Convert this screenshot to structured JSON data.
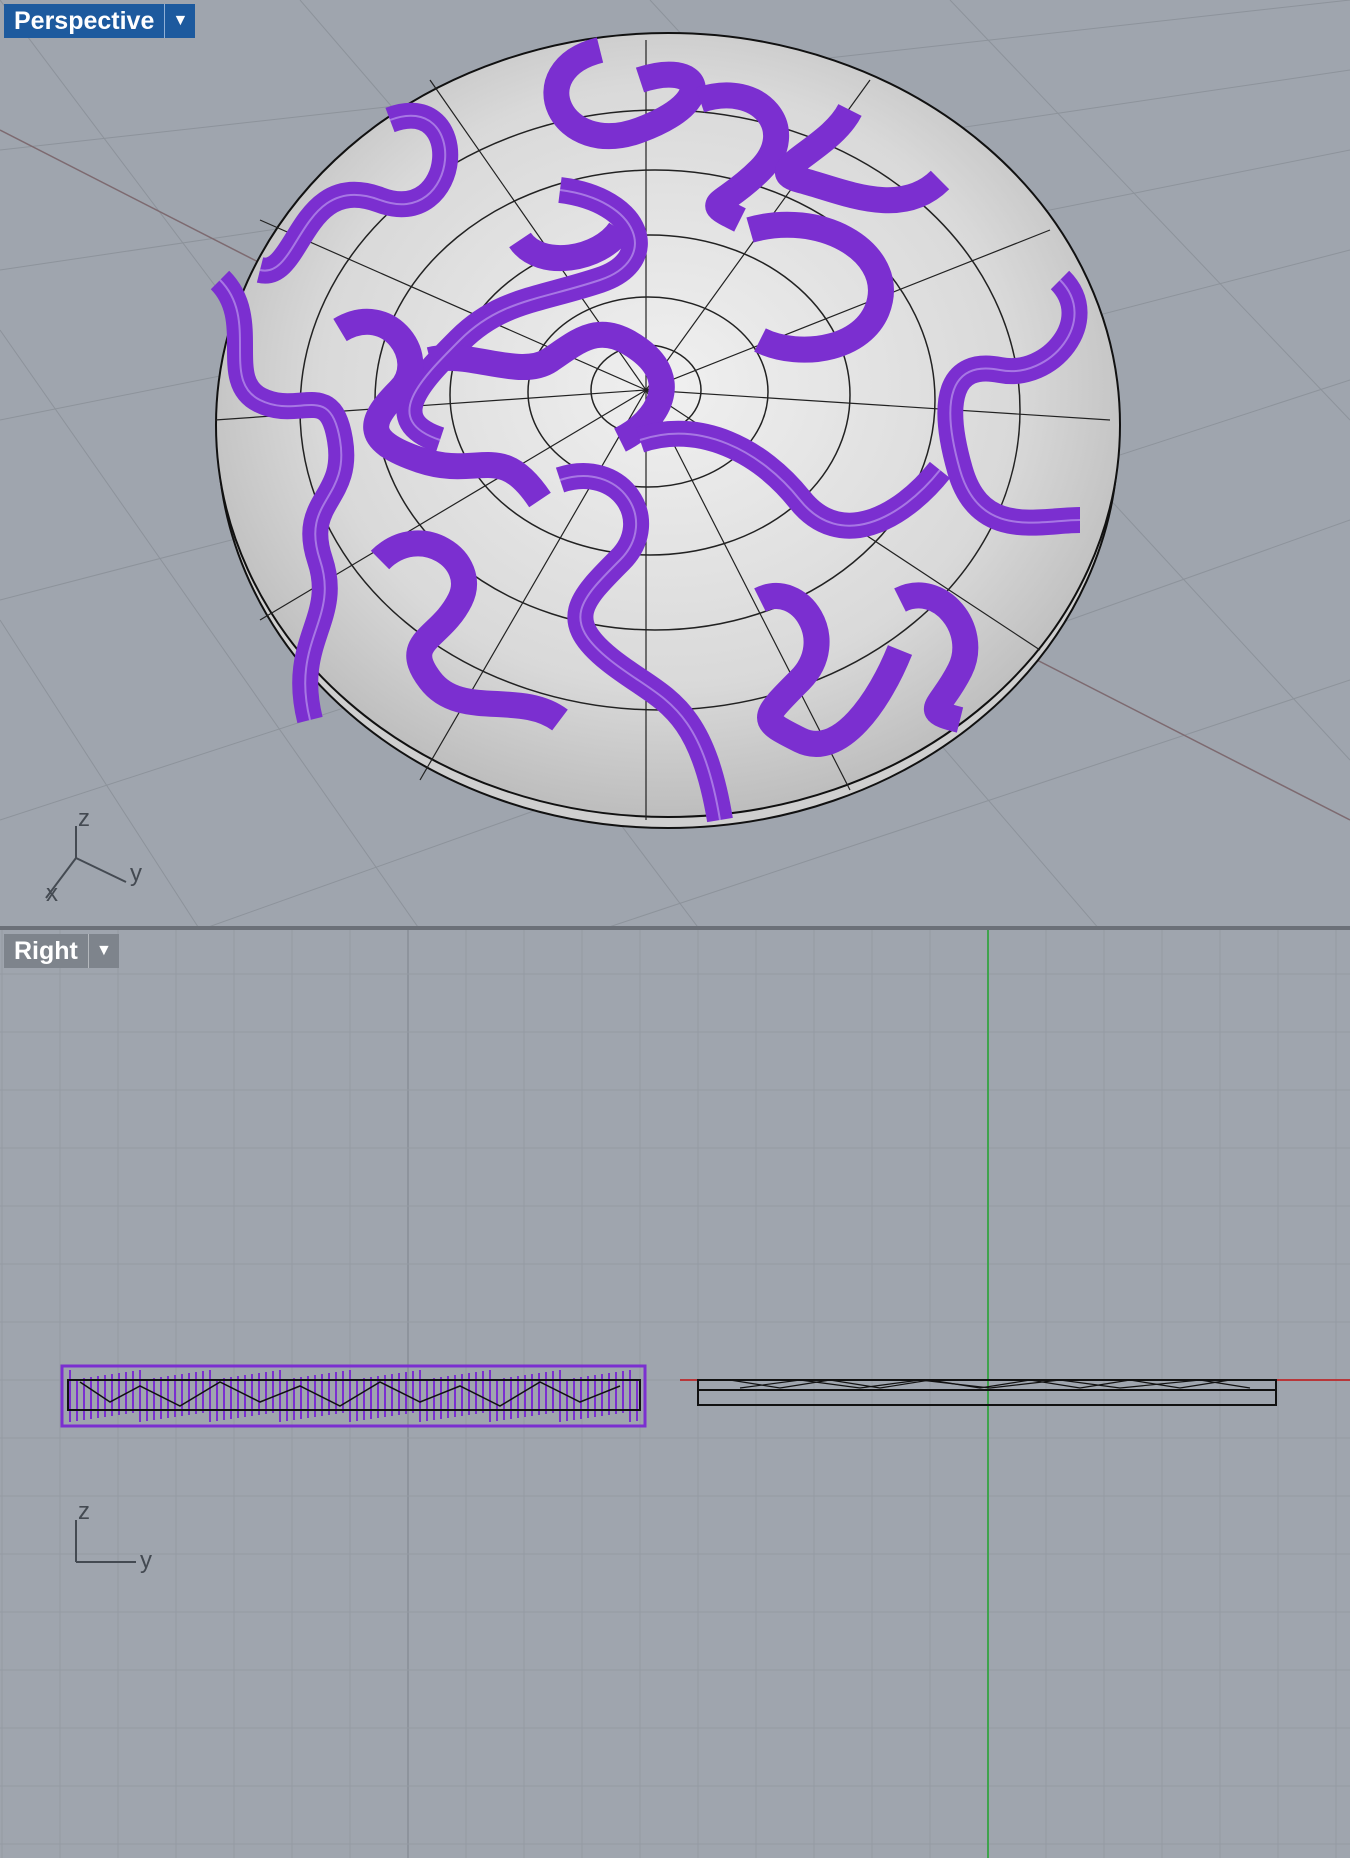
{
  "viewports": {
    "perspective": {
      "title": "Perspective",
      "menu_icon": "triangle-down"
    },
    "right": {
      "title": "Right",
      "menu_icon": "triangle-down"
    }
  },
  "axes": {
    "perspective": {
      "z": "z",
      "y": "y",
      "x": "x"
    },
    "right": {
      "z": "z",
      "y": "y"
    }
  },
  "colors": {
    "active_tab": "#1d5a9e",
    "inactive_tab": "#7e848c",
    "ribbon": "#7b2fd0",
    "background": "#9fa5ae",
    "y_axis": "#3fa34d",
    "x_axis": "#b8373a"
  }
}
